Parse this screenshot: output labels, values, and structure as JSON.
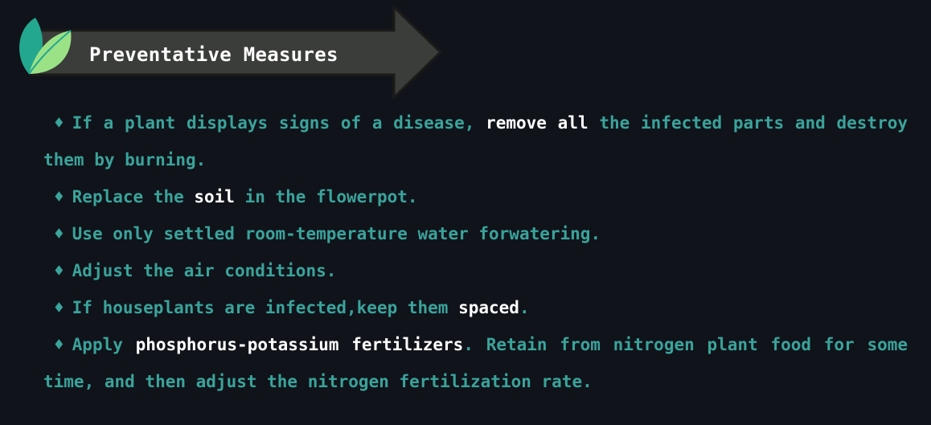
{
  "header": {
    "title": "Preventative Measures",
    "leaf_icon": "leaf-icon",
    "arrow_shape": "arrow-right-banner"
  },
  "colors": {
    "background": "#10131a",
    "text": "#3aa39b",
    "highlight": "#ffffff",
    "arrow_fill": "#3b3d3a",
    "arrow_stroke": "#1b1c1a",
    "leaf_dark": "#23a78f",
    "leaf_light": "#9be287"
  },
  "bullet_glyph": "♦",
  "items": [
    {
      "pre": "If a plant displays signs of a disease, ",
      "hl1": "remove all",
      "mid": " the infected parts and destroy them by burning.",
      "hl2": "",
      "post": ""
    },
    {
      "pre": "Replace the ",
      "hl1": "soil",
      "mid": " in the flowerpot.",
      "hl2": "",
      "post": ""
    },
    {
      "pre": "Use only settled room-temperature water forwatering.",
      "hl1": "",
      "mid": "",
      "hl2": "",
      "post": ""
    },
    {
      "pre": "Adjust the air conditions.",
      "hl1": "",
      "mid": "",
      "hl2": "",
      "post": ""
    },
    {
      "pre": "If houseplants are infected,keep them ",
      "hl1": "spaced",
      "mid": ".",
      "hl2": "",
      "post": ""
    },
    {
      "pre": "Apply ",
      "hl1": "phosphorus-potassium fertilizers",
      "mid": ". Retain from nitrogen plant food for some time, and then adjust the nitrogen fertilization rate.",
      "hl2": "",
      "post": ""
    }
  ]
}
